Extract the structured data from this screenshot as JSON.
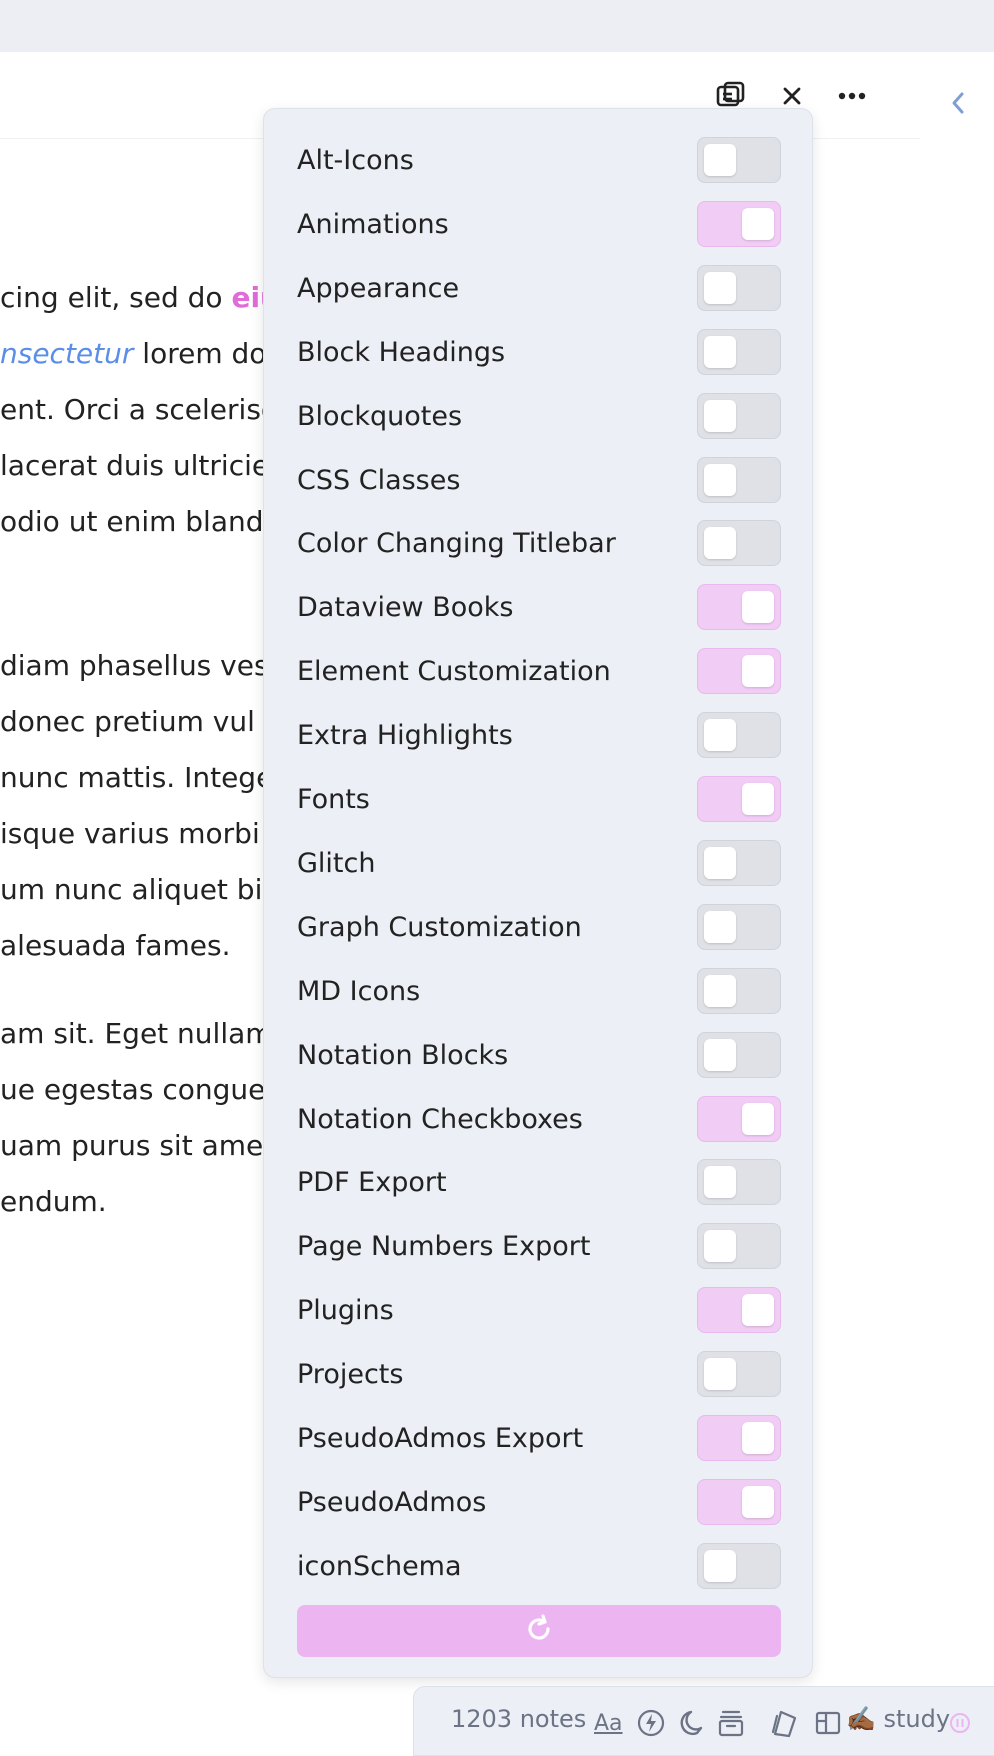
{
  "note": {
    "lines": [
      {
        "pre": "cing elit, sed do ",
        "em": "eiu",
        "post": ""
      },
      {
        "pre": "",
        "em": "nsectetur",
        "post": " lorem don"
      },
      {
        "pre": "ent. Orci a scelerisq",
        "em": "",
        "post": ""
      },
      {
        "pre": "lacerat duis ultricie",
        "em": "",
        "post": ""
      },
      {
        "pre": "odio ut enim bland",
        "em": "",
        "post": ""
      },
      {
        "pre": "diam phasellus vest",
        "em": "",
        "post": ""
      },
      {
        "pre": " donec pretium vul",
        "em": "",
        "post": ""
      },
      {
        "pre": "nunc mattis. Intege",
        "em": "",
        "post": ""
      },
      {
        "pre": "isque varius morbi e",
        "em": "",
        "post": ""
      },
      {
        "pre": "um nunc aliquet bib",
        "em": "",
        "post": ""
      },
      {
        "pre": "alesuada fames.",
        "em": "",
        "post": ""
      },
      {
        "pre": "am sit. Eget nullam",
        "em": "",
        "post": ""
      },
      {
        "pre": "ue egestas congue",
        "em": "",
        "post": ""
      },
      {
        "pre": "uam purus sit amet",
        "em": "",
        "post": ""
      },
      {
        "pre": "endum.",
        "em": "",
        "post": ""
      }
    ]
  },
  "header": {
    "icons": [
      "reading-view-icon",
      "close-icon",
      "more-options-icon"
    ],
    "collapse_icon": "chevron-left-icon"
  },
  "snippets": {
    "items": [
      {
        "label": "Alt-Icons",
        "on": false
      },
      {
        "label": "Animations",
        "on": true
      },
      {
        "label": "Appearance",
        "on": false
      },
      {
        "label": "Block Headings",
        "on": false
      },
      {
        "label": "Blockquotes",
        "on": false
      },
      {
        "label": "CSS Classes",
        "on": false
      },
      {
        "label": "Color Changing Titlebar",
        "on": false
      },
      {
        "label": "Dataview Books",
        "on": true
      },
      {
        "label": "Element Customization",
        "on": true
      },
      {
        "label": "Extra Highlights",
        "on": false
      },
      {
        "label": "Fonts",
        "on": true
      },
      {
        "label": "Glitch",
        "on": false
      },
      {
        "label": "Graph Customization",
        "on": false
      },
      {
        "label": "MD Icons",
        "on": false
      },
      {
        "label": "Notation Blocks",
        "on": false
      },
      {
        "label": "Notation Checkboxes",
        "on": true
      },
      {
        "label": "PDF Export",
        "on": false
      },
      {
        "label": "Page Numbers Export",
        "on": false
      },
      {
        "label": "Plugins",
        "on": true
      },
      {
        "label": "Projects",
        "on": false
      },
      {
        "label": "PseudoAdmos Export",
        "on": true
      },
      {
        "label": "PseudoAdmos",
        "on": true
      },
      {
        "label": "iconSchema",
        "on": false
      }
    ],
    "reload_icon": "reload-icon"
  },
  "statusbar": {
    "notes_count": "1203 notes",
    "font_label": "Aa",
    "vault_label": "✍🏾 study",
    "icons": [
      "font-size-icon",
      "lightning-icon",
      "moon-icon",
      "archive-icon",
      "cards-icon",
      "layout-icon",
      "pause-icon"
    ]
  },
  "colors": {
    "accent_on": "#f1ccf5",
    "accent_button": "#ecb5f2",
    "link_pink": "#e06bd9",
    "link_blue": "#5a8ee8"
  }
}
